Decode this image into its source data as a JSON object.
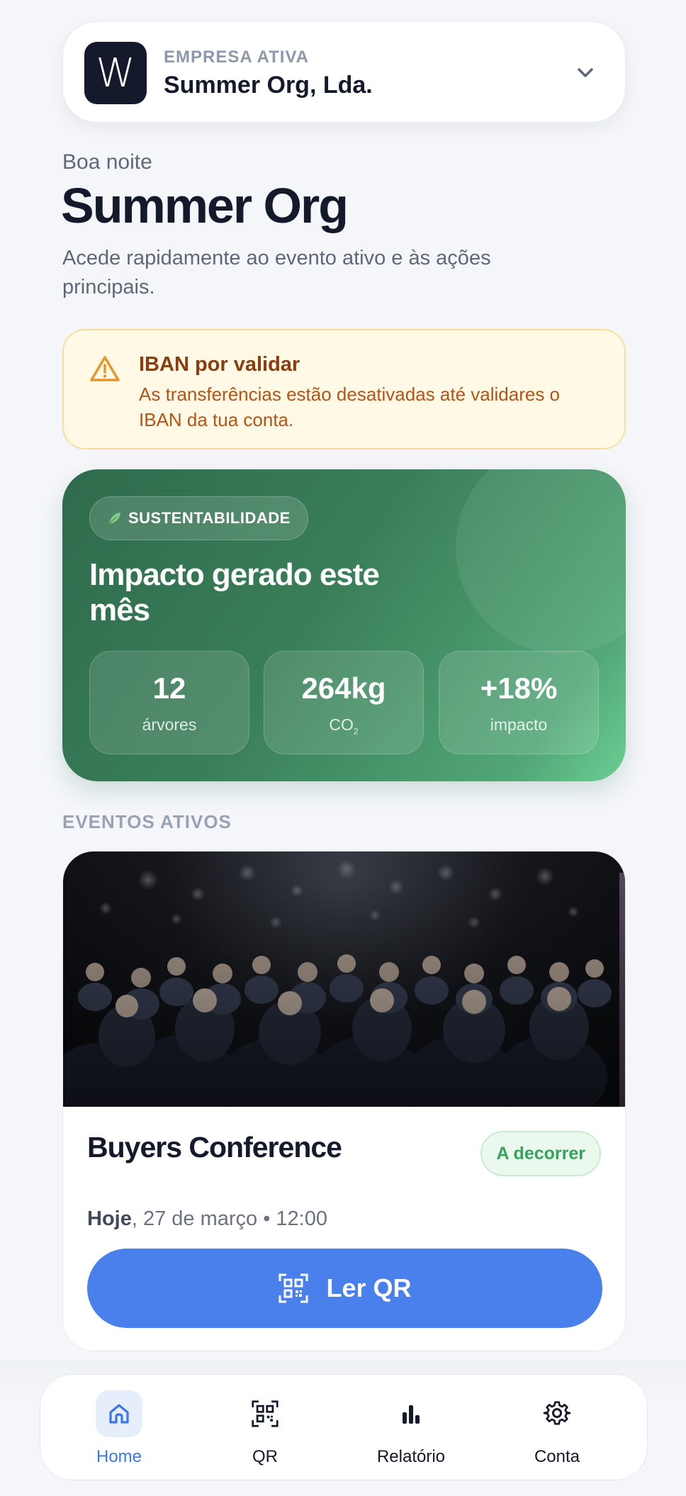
{
  "org": {
    "logo_letter": "W",
    "kicker": "EMPRESA ATIVA",
    "name": "Summer Org, Lda."
  },
  "greeting": "Boa noite",
  "title": "Summer Org",
  "subtitle": "Acede rapidamente ao evento ativo e às ações principais.",
  "warning": {
    "title": "IBAN por validar",
    "text": "As transferências estão desativadas até validares o IBAN da tua conta."
  },
  "sustainability": {
    "badge": "SUSTENTABILIDADE",
    "title": "Impacto gerado este mês",
    "stats": [
      {
        "value": "12",
        "label": "árvores"
      },
      {
        "value": "264kg",
        "label": "CO",
        "label_sub": "2"
      },
      {
        "value": "+18%",
        "label": "impacto"
      }
    ]
  },
  "section_label": "EVENTOS ATIVOS",
  "event": {
    "title": "Buyers Conference",
    "status": "A decorrer",
    "date_strong": "Hoje",
    "date_rest": ", 27 de março • 12:00",
    "button_label": "Ler QR"
  },
  "nav": {
    "items": [
      {
        "label": "Home",
        "icon": "home-icon"
      },
      {
        "label": "QR",
        "icon": "qr-icon"
      },
      {
        "label": "Relatório",
        "icon": "bar-chart-icon"
      },
      {
        "label": "Conta",
        "icon": "gear-icon"
      }
    ]
  },
  "colors": {
    "accent": "#4a80ec",
    "warning_bg": "#fff9e6",
    "success": "#36a35c",
    "sustain_green": "#3a7e59"
  }
}
